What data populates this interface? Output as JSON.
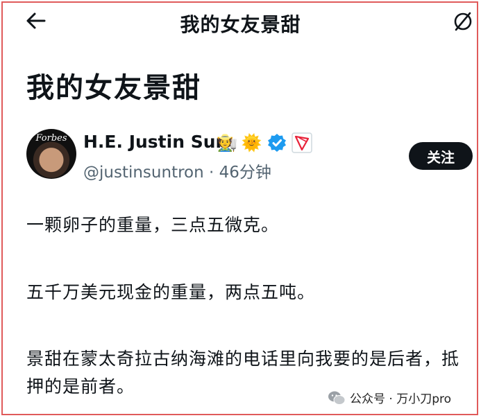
{
  "topbar": {
    "title": "我的女友景甜"
  },
  "post": {
    "heading": "我的女友景甜",
    "author": {
      "name": "H.E. Justin Sun",
      "avatar_text": "Forbes",
      "badges": [
        "🧑‍🌾",
        "🌞"
      ],
      "handle": "@justinsuntron",
      "time": " · 46分钟"
    },
    "follow_label": "关注",
    "paragraphs": [
      "一颗卵子的重量，三点五微克。",
      "五千万美元现金的重量，两点五吨。",
      "景甜在蒙太奇拉古纳海滩的电话里向我要的是后者，抵押的是前者。"
    ]
  },
  "watermark": {
    "text": "公众号 · 万小刀pro"
  },
  "colors": {
    "verified": "#1d9bf0",
    "tron": "#e8233a",
    "follow_bg": "#0f1419",
    "frame": "#e05a5a"
  }
}
